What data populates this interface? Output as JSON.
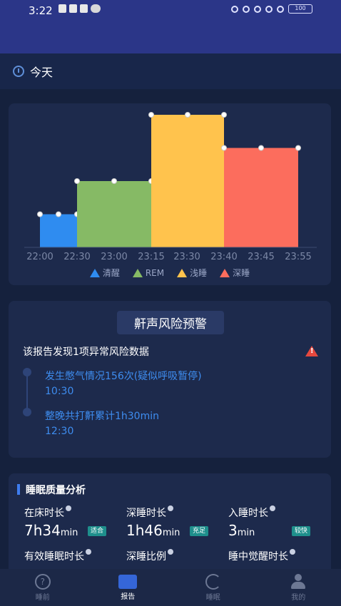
{
  "status_bar": {
    "time": "3:22",
    "battery": "100"
  },
  "today": {
    "label": "今天"
  },
  "chart_data": {
    "type": "bar",
    "categories": [
      "22:00",
      "22:30",
      "23:00",
      "23:15",
      "23:30",
      "23:40",
      "23:45",
      "23:55"
    ],
    "segments": [
      {
        "start": "22:00",
        "end": "22:30",
        "stage": "清醒",
        "level": 1
      },
      {
        "start": "22:30",
        "end": "23:15",
        "stage": "REM",
        "level": 2
      },
      {
        "start": "23:15",
        "end": "23:40",
        "stage": "浅睡",
        "level": 4
      },
      {
        "start": "23:40",
        "end": "23:55",
        "stage": "深睡",
        "level": 3
      }
    ],
    "series": [
      {
        "name": "清醒",
        "color": "#2f8cf0"
      },
      {
        "name": "REM",
        "color": "#86ba65"
      },
      {
        "name": "浅睡",
        "color": "#ffc34d"
      },
      {
        "name": "深睡",
        "color": "#fc6d5d"
      }
    ],
    "ylim": [
      0,
      4
    ],
    "grid": false,
    "legend": "bottom"
  },
  "risk": {
    "title": "鼾声风险预警",
    "summary": "该报告发现1项异常风险数据",
    "events": [
      {
        "text": "发生憋气情况156次(疑似呼吸暂停)",
        "time": "10:30"
      },
      {
        "text": "整晚共打鼾累计1h30min",
        "time": "12:30"
      }
    ]
  },
  "quality": {
    "title": "睡眠质量分析",
    "metrics": [
      {
        "label": "在床时长",
        "value": "7h34",
        "unit": "min",
        "badge": "适合"
      },
      {
        "label": "深睡时长",
        "value": "1h46",
        "unit": "min",
        "badge": "充足"
      },
      {
        "label": "入睡时长",
        "value": "3",
        "unit": "min",
        "badge": "较快"
      },
      {
        "label": "有效睡眠时长"
      },
      {
        "label": "深睡比例"
      },
      {
        "label": "睡中觉醒时长"
      }
    ]
  },
  "nav": {
    "items": [
      {
        "label": "睡前"
      },
      {
        "label": "报告"
      },
      {
        "label": "睡眠"
      },
      {
        "label": "我的"
      }
    ]
  }
}
